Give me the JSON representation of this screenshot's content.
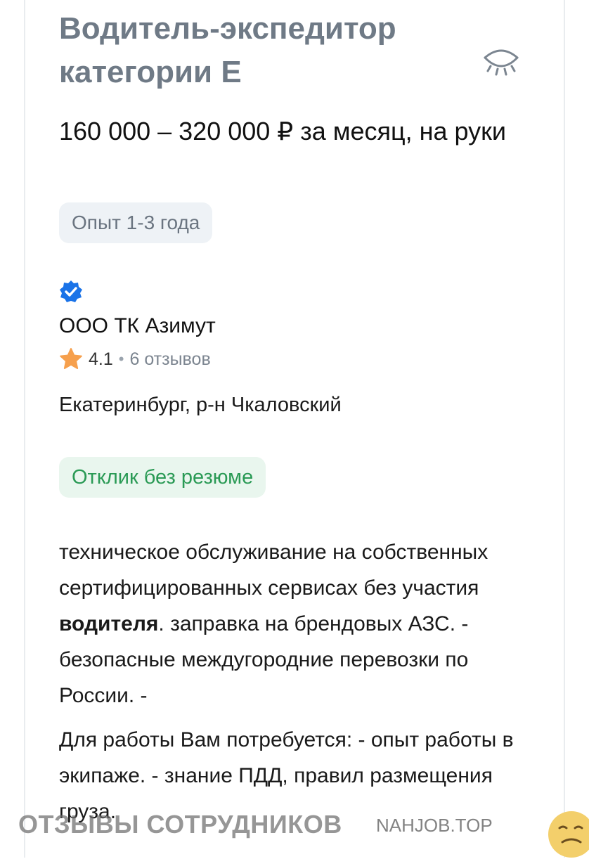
{
  "vacancy": {
    "title": "Водитель-экспедитор категории Е",
    "salary": "160 000 – 320 000 ₽ за месяц, на руки",
    "experience": "Опыт 1-3 года"
  },
  "employer": {
    "name": "ООО ТК Азимут",
    "rating": "4.1",
    "separator": "•",
    "reviews": "6 отзывов",
    "verified_icon": "verified-badge-icon",
    "star_icon": "star-icon"
  },
  "location": "Екатеринбург, р-н Чкаловский",
  "respond_badge": "Отклик без резюме",
  "description": {
    "p1_before": "техническое обслуживание на собственных сертифицированных сервисах без участия ",
    "p1_bold": "водителя",
    "p1_after": ". заправка на брендовых АЗС. - безопасные междугородние перевозки по России. -",
    "p2": "Для работы Вам потребуется: - опыт работы в экипаже. - знание ПДД, правил размещения груза."
  },
  "watermark": {
    "text": "ОТЗЫВЫ СОТРУДНИКОВ",
    "site": "NAHJOB.TOP"
  },
  "colors": {
    "title": "#6f7a86",
    "verified": "#1a73e8",
    "star": "#f6a04d",
    "respond_text": "#2a9a55",
    "respond_bg": "#e9f6ee",
    "badge_bg": "#eef2f6"
  }
}
